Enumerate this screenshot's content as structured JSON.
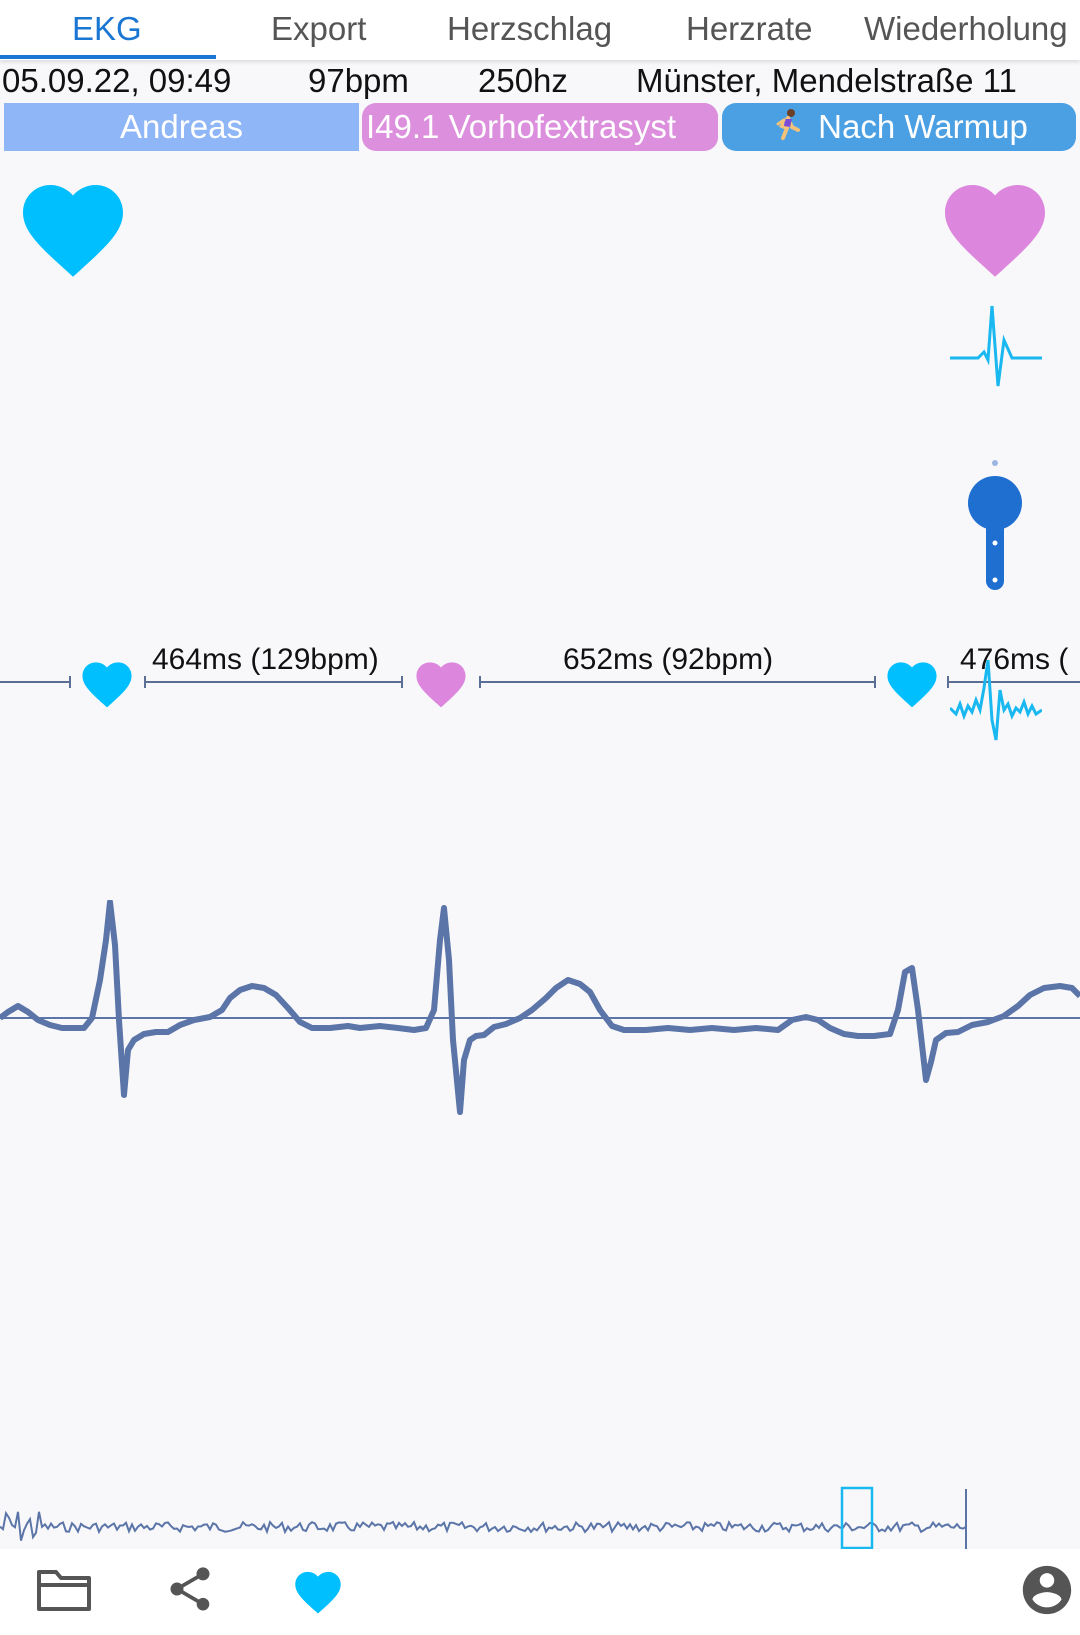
{
  "tabs": [
    {
      "label": "EKG",
      "active": true
    },
    {
      "label": "Export",
      "active": false
    },
    {
      "label": "Herzschlag",
      "active": false
    },
    {
      "label": "Herzrate",
      "active": false
    },
    {
      "label": "Wiederholung",
      "active": false
    }
  ],
  "recording": {
    "datetime": "05.09.22, 09:49",
    "bpm": "97bpm",
    "sample_rate": "250hz",
    "location": "Münster, Mendelstraße 11"
  },
  "chips": {
    "user": "Andreas",
    "diagnosis": "I49.1 Vorhofextrasyst",
    "note": "Nach Warmup"
  },
  "intervals": [
    {
      "label": "464ms (129bpm)"
    },
    {
      "label": "652ms (92bpm)"
    },
    {
      "label": "476ms ("
    }
  ],
  "colors": {
    "accent": "#1976d2",
    "normal_beat": "#00bfff",
    "extra_beat": "#dd86dd",
    "ecg_trace": "#5b75a8",
    "user_chip": "#8fb6f6",
    "diagnosis_chip": "#dc8fdc",
    "note_chip": "#4b9fe3"
  },
  "icons": {
    "top_left_heart": "heart-icon",
    "top_right_heart": "heart-icon",
    "waveform": "ecg-waveform-icon",
    "slider": "vertical-slider-handle",
    "bottom_bar": [
      "folder-icon",
      "share-icon",
      "heart-icon",
      "account-icon"
    ]
  }
}
